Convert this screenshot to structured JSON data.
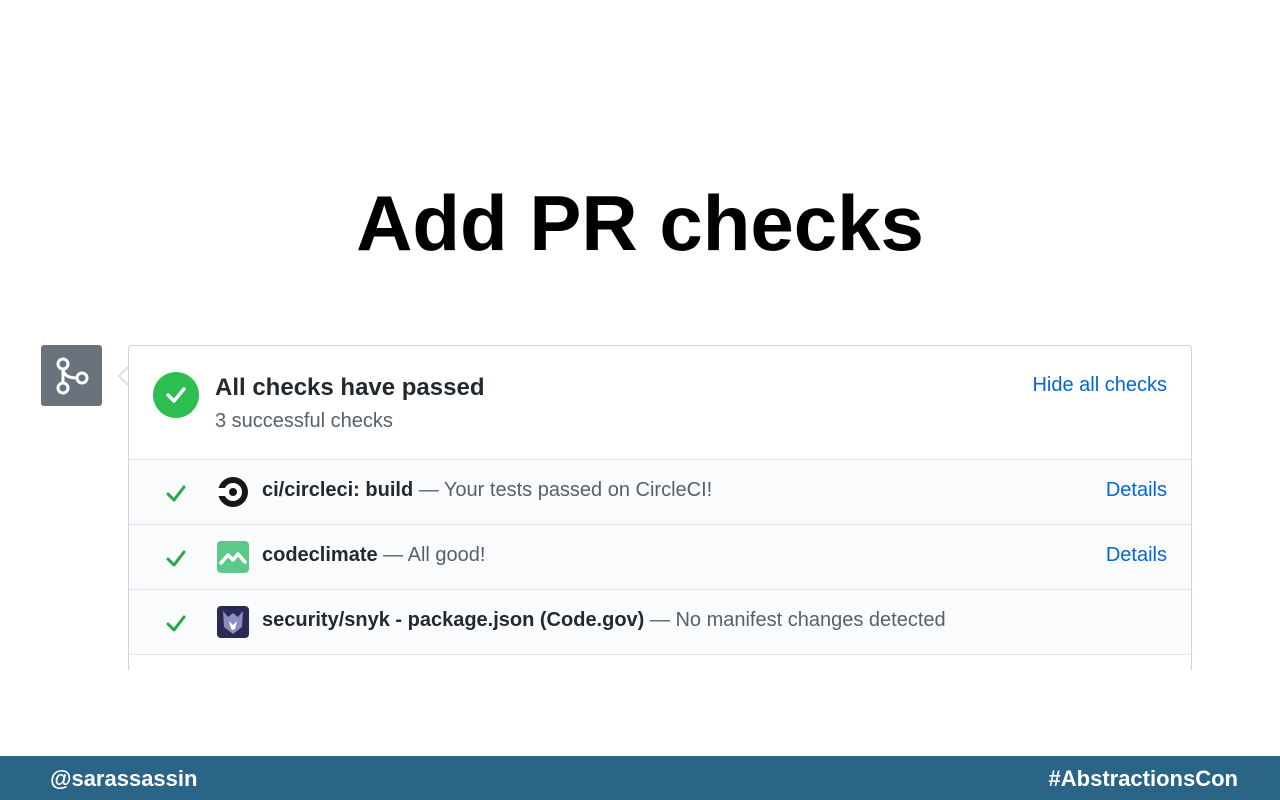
{
  "slide": {
    "title": "Add PR checks"
  },
  "checks_panel": {
    "badge_icon": "git-merge-icon",
    "status_icon": "check-circle-icon",
    "header_title": "All checks have passed",
    "header_subtitle": "3 successful checks",
    "hide_link": "Hide all checks",
    "rows": [
      {
        "logo": "circleci-logo-icon",
        "name": "ci/circleci: build",
        "description": "— Your tests passed on CircleCI!",
        "details_label": "Details"
      },
      {
        "logo": "codeclimate-logo-icon",
        "name": "codeclimate",
        "description": "— All good!",
        "details_label": "Details"
      },
      {
        "logo": "snyk-logo-icon",
        "name": "security/snyk - package.json (Code.gov)",
        "description": "— No manifest changes detected",
        "details_label": ""
      }
    ]
  },
  "footer": {
    "left_handle": "@sarassassin",
    "right_hashtag": "#AbstractionsCon"
  },
  "colors": {
    "success_green": "#2cbe4e",
    "link_blue": "#0366d6",
    "footer_bg": "#2a6587",
    "badge_gray": "#6a737d"
  }
}
